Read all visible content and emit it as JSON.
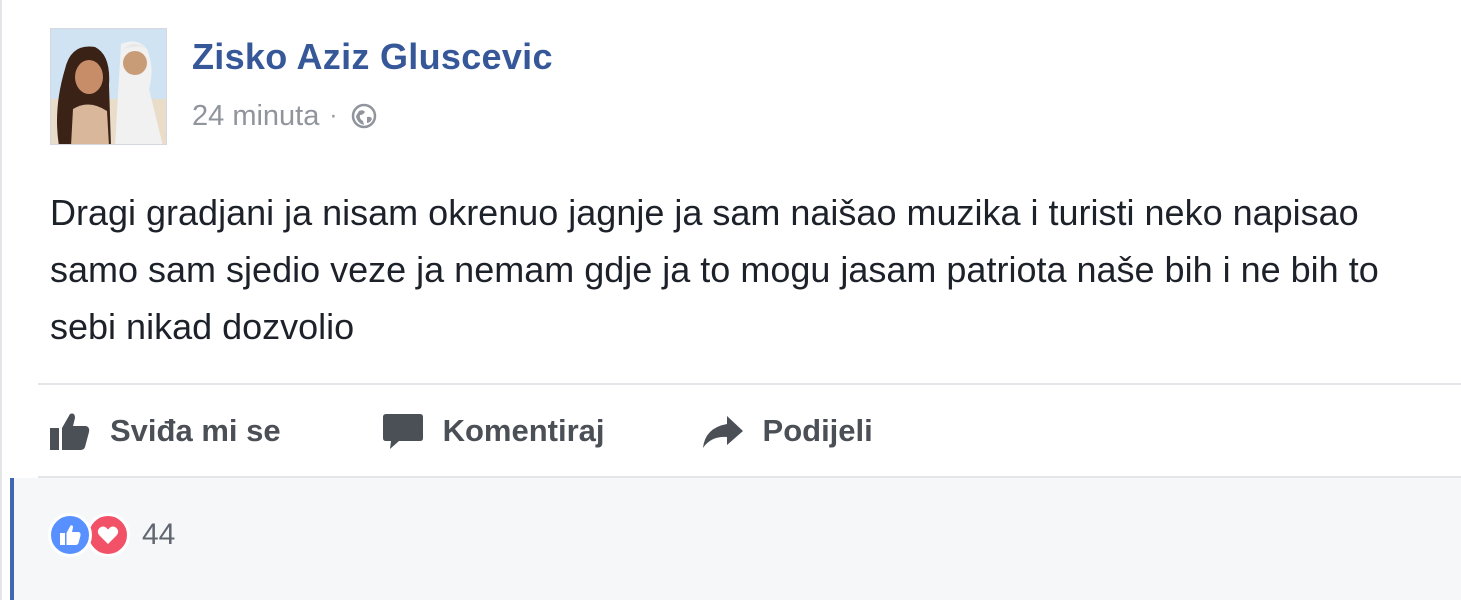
{
  "post": {
    "author": "Zisko Aziz Gluscevic",
    "time": "24 minuta",
    "separator": "·",
    "privacy_icon": "globe-icon",
    "text": "Dragi gradjani ja nisam okrenuo jagnje ja sam naišao muzika i turisti neko napisao samo sam sjedio veze ja nemam gdje ja to mogu jasam patriota naše bih i ne bih to sebi nikad dozvolio"
  },
  "actions": {
    "like_label": "Sviđa mi se",
    "comment_label": "Komentiraj",
    "share_label": "Podijeli"
  },
  "reactions": {
    "types": [
      "like",
      "love"
    ],
    "count": "44"
  },
  "colors": {
    "author": "#365899",
    "like": "#5890ff",
    "love": "#f25268",
    "accent_bar": "#4267b2"
  }
}
